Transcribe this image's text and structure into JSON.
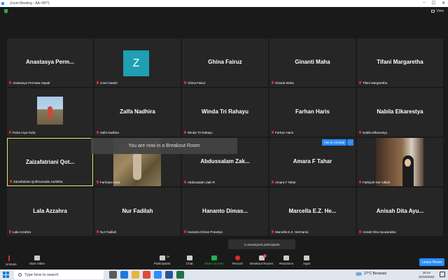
{
  "window": {
    "title": "Zoom Meeting - AA-VR?1",
    "view_label": "View"
  },
  "participants": [
    {
      "display": "Anastasya  Perm...",
      "name": "Anastasya Permata Hayati"
    },
    {
      "display": "Z",
      "name": "zoom baa04"
    },
    {
      "display": "Ghina Fairuz",
      "name": "Ghina Fairuz"
    },
    {
      "display": "Ginanti Maha",
      "name": "Ginanti Maha"
    },
    {
      "display": "Tifani Margaretha",
      "name": "Tifani Margaretha"
    },
    {
      "display": "",
      "name": "Putra Arya Yuda"
    },
    {
      "display": "Zalfa Nadhira",
      "name": "Zalfa Nadhira"
    },
    {
      "display": "Winda Tri Rahayu",
      "name": "Winda Tri Rahayu"
    },
    {
      "display": "Farhan Haris",
      "name": "Farhan Haris"
    },
    {
      "display": "Nabila Elkarestya",
      "name": "Nabila Elkarestya"
    },
    {
      "display": "Zaizafatriani  Qot...",
      "name": "Zaizafatriani Qothrunnada Joefatha"
    },
    {
      "display": "",
      "name": "Farhatun Nisa"
    },
    {
      "display": "Abdussalam  Zak...",
      "name": "Abdussalam Zaki R"
    },
    {
      "display": "Amara F Tahar",
      "name": "Amara F Tahar"
    },
    {
      "display": "",
      "name": "Fathiyah Nur Adilah"
    },
    {
      "display": "Lala Azzahra",
      "name": "Lala Azzahra"
    },
    {
      "display": "Nur Fadilah",
      "name": "Nur Fadilah"
    },
    {
      "display": "Hananto  Dimas...",
      "name": "Hananto Dimas Prasetyo"
    },
    {
      "display": "Marcella E.Z.  He...",
      "name": "Marcella E.Z. Hermanto"
    },
    {
      "display": "Anisah Dita  Ayu...",
      "name": "Anisah Dita Ayuwandira"
    }
  ],
  "ask_unmute": "Ask to Unmute",
  "ask_more": "···",
  "toast": "You are now in a Breakout Room",
  "unassigned": "4 unassigned participants",
  "toolbar": {
    "unmute": "Unmute",
    "start_video": "Start Video",
    "participants": "Participants",
    "participants_count": "20",
    "chat": "Chat",
    "share_screen": "Share Screen",
    "record": "Record",
    "breakout_rooms": "Breakout Rooms",
    "breakout_badge": "4",
    "reactions": "Reactions",
    "apps": "Apps",
    "leave": "Leave Room"
  },
  "taskbar": {
    "search_placeholder": "Type here to search",
    "weather": "27°C  Berawan",
    "time": "18:44",
    "date": "31/03/2022"
  },
  "colors": {
    "accent": "#2d8cff",
    "muted_red": "#e02828",
    "share_green": "#23b14d",
    "active_border": "#e6e67a"
  }
}
